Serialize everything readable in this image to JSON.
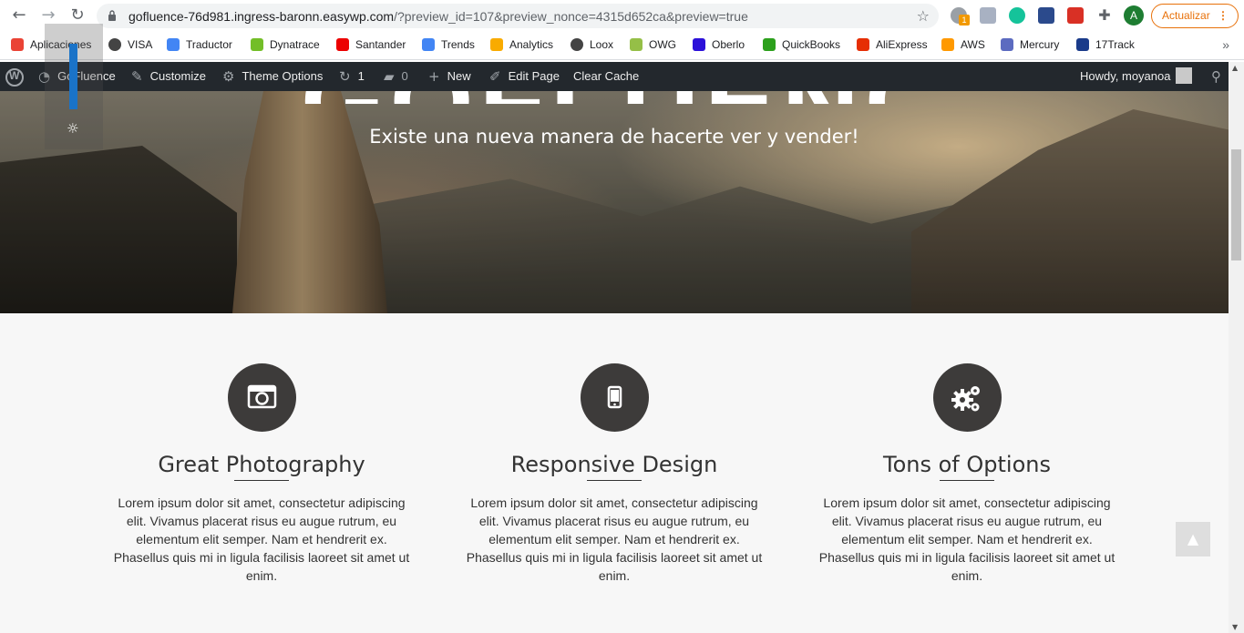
{
  "browser": {
    "url_host": "gofluence-76d981.ingress-baronn.easywp.com",
    "url_rest": "/?preview_id=107&preview_nonce=4315d652ca&preview=true",
    "update_label": "Actualizar",
    "profile_initial": "A",
    "extension_badge": "1"
  },
  "bookmarks": [
    {
      "label": "Aplicaciones",
      "icon": "apps-grid-icon",
      "color": "#ea4335"
    },
    {
      "label": "VISA",
      "icon": "globe-icon",
      "color": "#444444"
    },
    {
      "label": "Traductor",
      "icon": "google-translate-icon",
      "color": "#4285f4"
    },
    {
      "label": "Dynatrace",
      "icon": "dynatrace-icon",
      "color": "#73be28"
    },
    {
      "label": "Santander",
      "icon": "santander-icon",
      "color": "#ec0000"
    },
    {
      "label": "Trends",
      "icon": "trends-icon",
      "color": "#4285f4"
    },
    {
      "label": "Analytics",
      "icon": "analytics-icon",
      "color": "#f9ab00"
    },
    {
      "label": "Loox",
      "icon": "globe-icon",
      "color": "#444444"
    },
    {
      "label": "OWG",
      "icon": "shopify-icon",
      "color": "#95bf47"
    },
    {
      "label": "Oberlo",
      "icon": "oberlo-icon",
      "color": "#2c11d9"
    },
    {
      "label": "QuickBooks",
      "icon": "quickbooks-icon",
      "color": "#2ca01c"
    },
    {
      "label": "AliExpress",
      "icon": "aliexpress-icon",
      "color": "#e62e04"
    },
    {
      "label": "AWS",
      "icon": "aws-icon",
      "color": "#ff9900"
    },
    {
      "label": "Mercury",
      "icon": "mercury-icon",
      "color": "#5c6bc0"
    },
    {
      "label": "17Track",
      "icon": "17track-icon",
      "color": "#1a3b8a"
    }
  ],
  "wpbar": {
    "site_name": "GoFluence",
    "customize": "Customize",
    "theme_options": "Theme Options",
    "updates_count": "1",
    "comments_count": "0",
    "new": "New",
    "edit_page": "Edit Page",
    "clear_cache": "Clear Cache",
    "howdy": "Howdy, moyanoa"
  },
  "hero": {
    "title_fragment": "GOFLUENCE",
    "subtitle": "Existe una nueva manera de hacerte ver y vender!"
  },
  "features": [
    {
      "icon": "camera-icon",
      "title": "Great Photography",
      "text": "Lorem ipsum dolor sit amet, consectetur adipiscing elit. Vivamus placerat risus eu augue rutrum, eu elementum elit semper. Nam et hendrerit ex. Phasellus quis mi in ligula facilisis laoreet sit amet ut enim."
    },
    {
      "icon": "mobile-icon",
      "title": "Responsive Design",
      "text": "Lorem ipsum dolor sit amet, consectetur adipiscing elit. Vivamus placerat risus eu augue rutrum, eu elementum elit semper. Nam et hendrerit ex. Phasellus quis mi in ligula facilisis laoreet sit amet ut enim."
    },
    {
      "icon": "gears-icon",
      "title": "Tons of Options",
      "text": "Lorem ipsum dolor sit amet, consectetur adipiscing elit. Vivamus placerat risus eu augue rutrum, eu elementum elit semper. Nam et hendrerit ex. Phasellus quis mi in ligula facilisis laoreet sit amet ut enim."
    }
  ],
  "colors": {
    "wp_bar": "#23282d",
    "feature_circle": "#3d3b3a",
    "update_accent": "#e8710a"
  }
}
